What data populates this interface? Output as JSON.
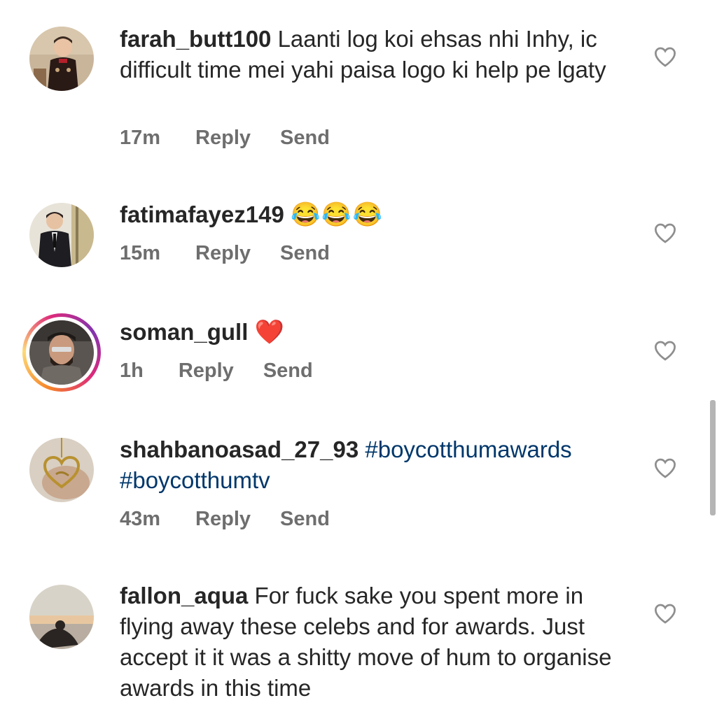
{
  "comments": [
    {
      "username": "farah_butt100",
      "text": "Laanti log koi ehsas nhi Inhy, ic difficult time mei yahi paisa logo ki help pe lgaty",
      "time": "17m",
      "reply_label": "Reply",
      "send_label": "Send"
    },
    {
      "username": "fatimafayez149",
      "text": "😂😂😂",
      "time": "15m",
      "reply_label": "Reply",
      "send_label": "Send"
    },
    {
      "username": "soman_gull",
      "text": "❤️",
      "time": "1h",
      "reply_label": "Reply",
      "send_label": "Send",
      "has_story": true
    },
    {
      "username": "shahbanoasad_27_93",
      "text": "#boycotthumawards #boycotthumtv",
      "time": "43m",
      "reply_label": "Reply",
      "send_label": "Send"
    },
    {
      "username": "fallon_aqua",
      "text": "For fuck sake you spent more in flying away these celebs and for awards. Just accept it it was a shitty move of hum to organise awards in this time"
    }
  ],
  "icons": {
    "like": "heart-outline-icon"
  },
  "colors": {
    "text": "#262626",
    "meta": "#6e6e6e",
    "hashtag": "#00376b",
    "story_ring": [
      "#f58529",
      "#dd2a7b",
      "#8134af"
    ]
  }
}
